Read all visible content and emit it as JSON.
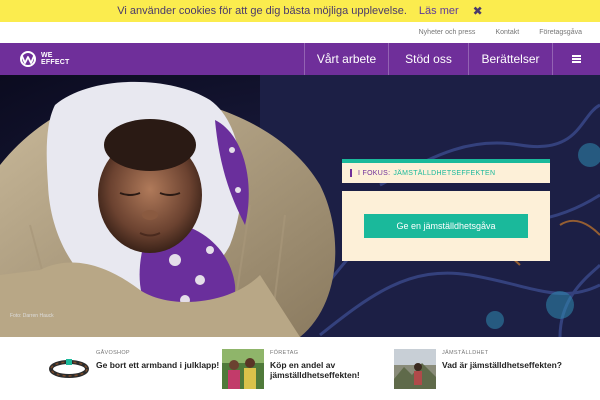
{
  "cookie": {
    "message": "Vi använder cookies för att ge dig bästa möjliga upplevelse.",
    "more_label": "Läs mer",
    "close_symbol": "✖"
  },
  "utility_links": [
    "Nyheter och press",
    "Kontakt",
    "Företagsgåva"
  ],
  "logo": {
    "line1": "WE",
    "line2": "EFFECT"
  },
  "nav": {
    "items": [
      "Vårt arbete",
      "Stöd oss",
      "Berättelser"
    ],
    "menu_icon": "hamburger-icon"
  },
  "hero": {
    "photo_credit": "Foto: Darren Hauck",
    "focus_key": "I FOKUS:",
    "focus_value": "JÄMSTÄLLDHETSEFFEKTEN",
    "cta_label": "Ge en jämställdhetsgåva"
  },
  "promos": [
    {
      "category": "GÅVOSHOP",
      "title": "Ge bort ett armband i julklapp!"
    },
    {
      "category": "FÖRETAG",
      "title_line1": "Köp en andel av",
      "title_line2": "jämställdhetseffekten!"
    },
    {
      "category": "JÄMSTÄLLDHET",
      "title": "Vad är jämställdhetseffekten?"
    }
  ],
  "colors": {
    "cookie_bg": "#fbec4e",
    "brand_purple": "#6f2f9a",
    "accent_teal": "#1ab99b",
    "focus_bg": "#fdf0d8"
  }
}
